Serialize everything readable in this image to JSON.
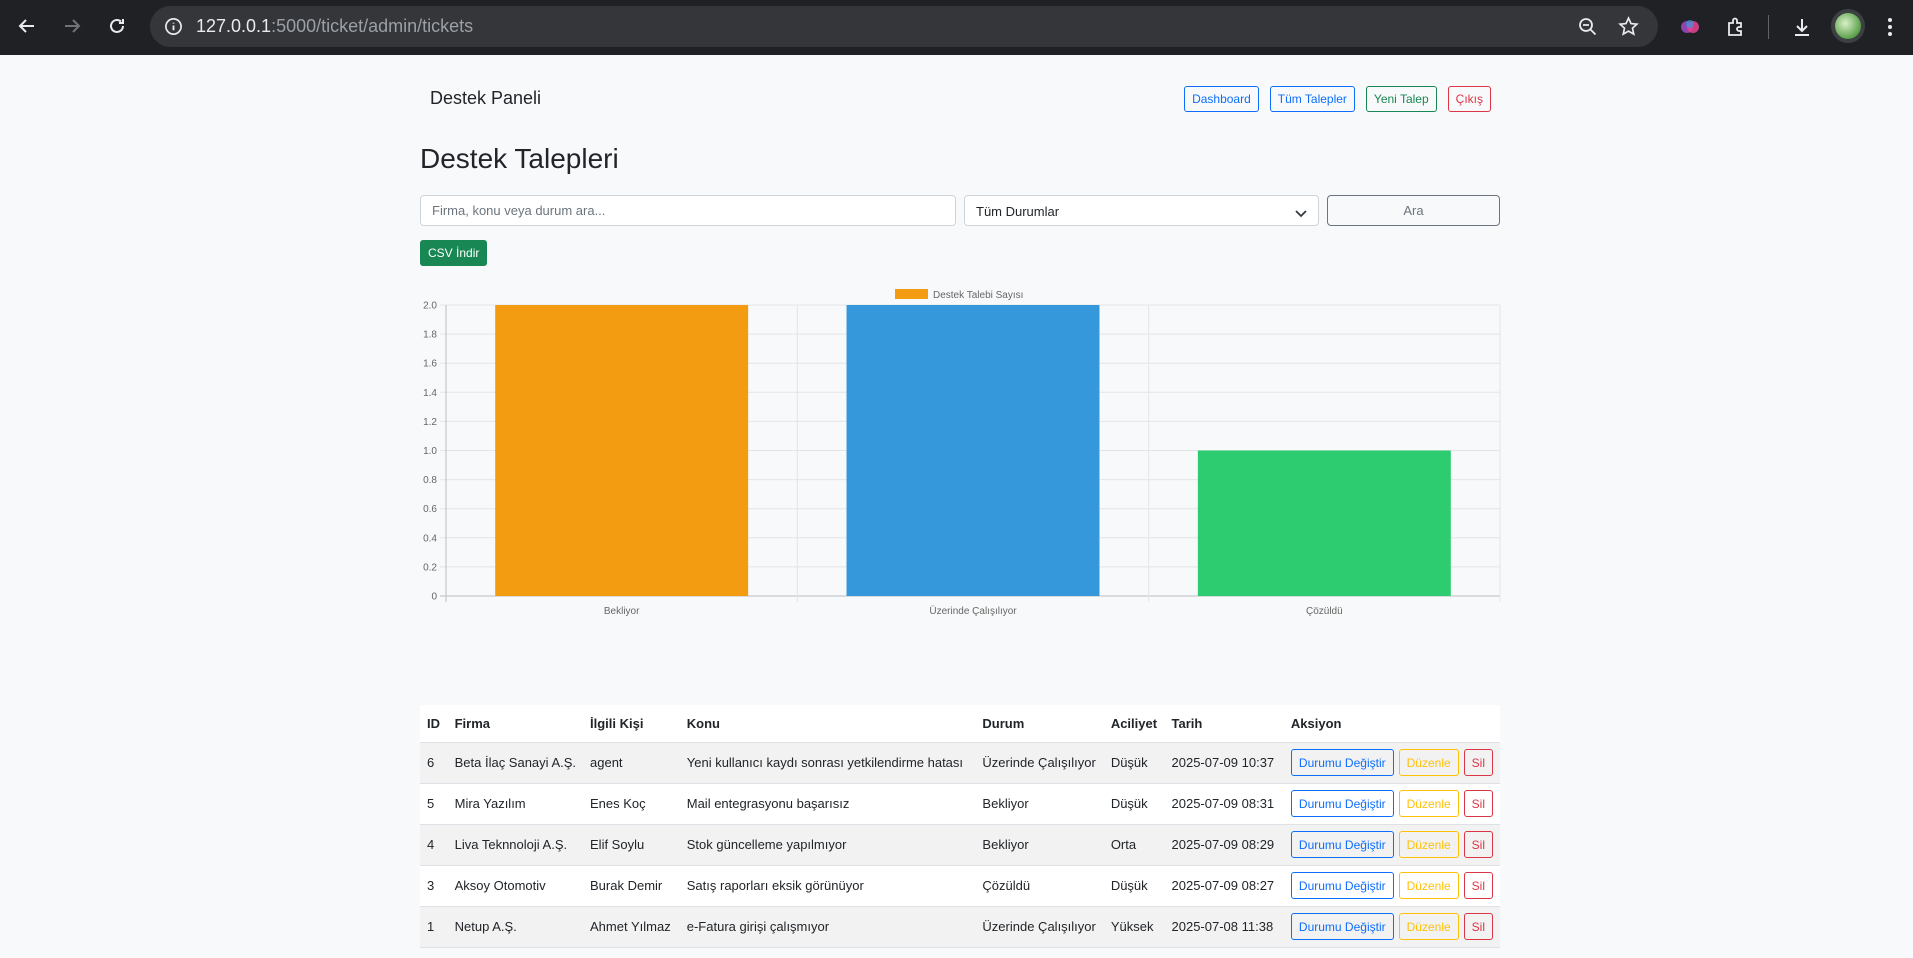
{
  "browser": {
    "url_host": "127.0.0.1",
    "url_rest": ":5000/ticket/admin/tickets"
  },
  "navbar": {
    "brand": "Destek Paneli",
    "links": [
      {
        "label": "Dashboard",
        "variant": "primary"
      },
      {
        "label": "Tüm Talepler",
        "variant": "primary"
      },
      {
        "label": "Yeni Talep",
        "variant": "success"
      },
      {
        "label": "Çıkış",
        "variant": "danger"
      }
    ]
  },
  "page": {
    "title": "Destek Talepleri"
  },
  "filters": {
    "search_placeholder": "Firma, konu veya durum ara...",
    "status_selected": "Tüm Durumlar",
    "search_button": "Ara",
    "csv_button": "CSV İndir"
  },
  "chart_data": {
    "type": "bar",
    "categories": [
      "Bekliyor",
      "Üzerinde Çalışılıyor",
      "Çözüldü"
    ],
    "series": [
      {
        "name": "Destek Talebi Sayısı",
        "values": [
          2,
          2,
          1
        ]
      }
    ],
    "colors": [
      "#f39c12",
      "#3498db",
      "#2ecc71"
    ],
    "legend_color": "#f39c12",
    "ylim": [
      0,
      2
    ],
    "yticks": [
      "0",
      "0.2",
      "0.4",
      "0.6",
      "0.8",
      "1.0",
      "1.2",
      "1.4",
      "1.6",
      "1.8",
      "2.0"
    ],
    "legend_position": "top-center",
    "grid": true
  },
  "table": {
    "headers": [
      "ID",
      "Firma",
      "İlgili Kişi",
      "Konu",
      "Durum",
      "Aciliyet",
      "Tarih",
      "Aksiyon"
    ],
    "action_labels": {
      "change_status": "Durumu Değiştir",
      "edit": "Düzenle",
      "delete": "Sil"
    },
    "rows": [
      {
        "id": "6",
        "firma": "Beta İlaç Sanayi A.Ş.",
        "kisi": "agent",
        "konu": "Yeni kullanıcı kaydı sonrası yetkilendirme hatası",
        "durum": "Üzerinde Çalışılıyor",
        "aciliyet": "Düşük",
        "tarih": "2025-07-09 10:37"
      },
      {
        "id": "5",
        "firma": "Mira Yazılım",
        "kisi": "Enes Koç",
        "konu": "Mail entegrasyonu başarısız",
        "durum": "Bekliyor",
        "aciliyet": "Düşük",
        "tarih": "2025-07-09 08:31"
      },
      {
        "id": "4",
        "firma": "Liva Teknnoloji A.Ş.",
        "kisi": "Elif Soylu",
        "konu": "Stok güncelleme yapılmıyor",
        "durum": "Bekliyor",
        "aciliyet": "Orta",
        "tarih": "2025-07-09 08:29"
      },
      {
        "id": "3",
        "firma": "Aksoy Otomotiv",
        "kisi": "Burak Demir",
        "konu": "Satış raporları eksik görünüyor",
        "durum": "Çözüldü",
        "aciliyet": "Düşük",
        "tarih": "2025-07-09 08:27"
      },
      {
        "id": "1",
        "firma": "Netup A.Ş.",
        "kisi": "Ahmet Yılmaz",
        "konu": "e-Fatura girişi çalışmıyor",
        "durum": "Üzerinde Çalışılıyor",
        "aciliyet": "Yüksek",
        "tarih": "2025-07-08 11:38"
      }
    ]
  }
}
